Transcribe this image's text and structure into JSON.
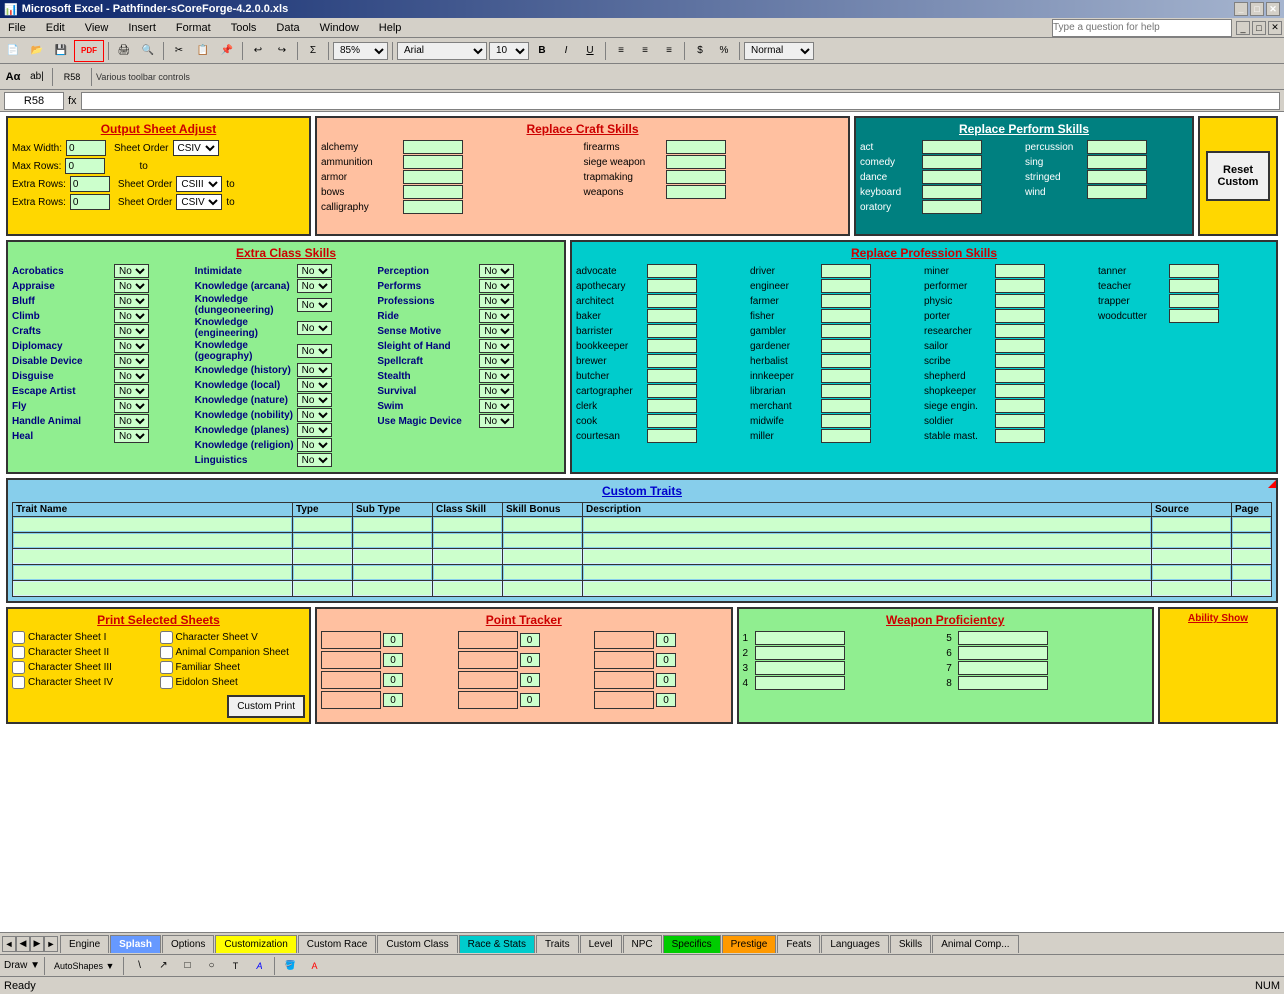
{
  "window": {
    "title": "Microsoft Excel - Pathfinder-sCoreForge-4.2.0.0.xls"
  },
  "menu": {
    "items": [
      "File",
      "Edit",
      "View",
      "Insert",
      "Format",
      "Tools",
      "Data",
      "Window",
      "Help"
    ]
  },
  "formula_bar": {
    "cell_ref": "R58",
    "formula": ""
  },
  "cell_question": "Type a question for help",
  "zoom": "85%",
  "font": "Arial",
  "font_size": "10",
  "normal_label": "Normal",
  "output_sheet": {
    "title": "Output Sheet Adjust",
    "fields": [
      {
        "label": "Max Width:",
        "value": "0",
        "order_label": "Sheet Order",
        "order_value": "CSIV",
        "to": ""
      },
      {
        "label": "Max Rows:",
        "value": "0",
        "to": "to"
      },
      {
        "label": "Extra Rows:",
        "value": "0",
        "order_label": "Sheet Order",
        "order_value": "CSIII",
        "to": "to"
      },
      {
        "label": "Extra Rows:",
        "value": "0",
        "order_label": "Sheet Order",
        "order_value": "CSIV",
        "to": "to"
      }
    ]
  },
  "craft_skills": {
    "title": "Replace Craft Skills",
    "items": [
      {
        "label": "alchemy",
        "col2_label": "firearms"
      },
      {
        "label": "ammunition",
        "col2_label": "siege weapon"
      },
      {
        "label": "armor",
        "col2_label": "trapmaking"
      },
      {
        "label": "bows",
        "col2_label": "weapons"
      },
      {
        "label": "calligraphy",
        "col2_label": ""
      }
    ]
  },
  "perform_skills": {
    "title": "Replace Perform Skills",
    "col1": [
      "act",
      "comedy",
      "dance",
      "keyboard",
      "oratory"
    ],
    "col2": [
      "percussion",
      "sing",
      "stringed",
      "wind"
    ]
  },
  "reset_button": {
    "line1": "Reset",
    "line2": "Custom"
  },
  "extra_class_skills": {
    "title": "Extra Class Skills",
    "col1": [
      {
        "label": "Acrobatics",
        "value": "No"
      },
      {
        "label": "Appraise",
        "value": "No"
      },
      {
        "label": "Bluff",
        "value": "No"
      },
      {
        "label": "Climb",
        "value": "No"
      },
      {
        "label": "Crafts",
        "value": "No"
      },
      {
        "label": "Diplomacy",
        "value": "No"
      },
      {
        "label": "Disable Device",
        "value": "No"
      },
      {
        "label": "Disguise",
        "value": "No"
      },
      {
        "label": "Escape Artist",
        "value": "No"
      },
      {
        "label": "Fly",
        "value": "No"
      },
      {
        "label": "Handle Animal",
        "value": "No"
      },
      {
        "label": "Heal",
        "value": "No"
      }
    ],
    "col2": [
      {
        "label": "Intimidate",
        "value": "No"
      },
      {
        "label": "Knowledge (arcana)",
        "value": "No"
      },
      {
        "label": "Knowledge (dungeoneering)",
        "value": "No"
      },
      {
        "label": "Knowledge (engineering)",
        "value": "No"
      },
      {
        "label": "Knowledge (geography)",
        "value": "No"
      },
      {
        "label": "Knowledge (history)",
        "value": "No"
      },
      {
        "label": "Knowledge (local)",
        "value": "No"
      },
      {
        "label": "Knowledge (nature)",
        "value": "No"
      },
      {
        "label": "Knowledge (nobility)",
        "value": "No"
      },
      {
        "label": "Knowledge (planes)",
        "value": "No"
      },
      {
        "label": "Knowledge (religion)",
        "value": "No"
      },
      {
        "label": "Linguistics",
        "value": "No"
      }
    ],
    "col3": [
      {
        "label": "Perception",
        "value": "No"
      },
      {
        "label": "Performs",
        "value": "No"
      },
      {
        "label": "Professions",
        "value": "No"
      },
      {
        "label": "Ride",
        "value": "No"
      },
      {
        "label": "Sense Motive",
        "value": "No"
      },
      {
        "label": "Sleight of Hand",
        "value": "No"
      },
      {
        "label": "Spellcraft",
        "value": "No"
      },
      {
        "label": "Stealth",
        "value": "No"
      },
      {
        "label": "Survival",
        "value": "No"
      },
      {
        "label": "Swim",
        "value": "No"
      },
      {
        "label": "Use Magic Device",
        "value": "No"
      }
    ]
  },
  "profession_skills": {
    "title": "Replace Profession Skills",
    "col1": [
      "advocate",
      "apothecary",
      "architect",
      "baker",
      "barrister",
      "bookkeeper",
      "brewer",
      "butcher",
      "cartographer",
      "clerk",
      "cook",
      "courtesan"
    ],
    "col2": [
      "driver",
      "engineer",
      "farmer",
      "fisher",
      "gambler",
      "gardener",
      "herbalist",
      "innkeeper",
      "librarian",
      "merchant",
      "midwife",
      "miller"
    ],
    "col3": [
      "miner",
      "performer",
      "physic",
      "porter",
      "researcher",
      "sailor",
      "scribe",
      "shepherd",
      "shopkeeper",
      "siege engin.",
      "soldier",
      "stable mast."
    ],
    "col4": [
      "tanner",
      "teacher",
      "trapper",
      "woodcutter"
    ]
  },
  "custom_traits": {
    "title": "Custom Traits",
    "columns": [
      "Trait Name",
      "Type",
      "Sub Type",
      "Class Skill",
      "Skill Bonus",
      "Description",
      "Source",
      "Page"
    ],
    "rows": 5
  },
  "print_sheets": {
    "title": "Print Selected Sheets",
    "checkboxes_col1": [
      "Character Sheet I",
      "Character Sheet II",
      "Character Sheet III",
      "Character Sheet IV"
    ],
    "checkboxes_col2": [
      "Character Sheet V",
      "Animal Companion Sheet",
      "Familiar Sheet",
      "Eidolon Sheet"
    ],
    "custom_print": "Custom Print"
  },
  "point_tracker": {
    "title": "Point Tracker"
  },
  "weapon_proficiency": {
    "title": "Weapon Proficientcy",
    "numbers": [
      "1",
      "2",
      "3",
      "4",
      "5",
      "6",
      "7",
      "8"
    ]
  },
  "ability_show": {
    "title": "Ability Show"
  },
  "tabs": [
    {
      "label": "Engine",
      "style": "normal"
    },
    {
      "label": "Splash",
      "style": "blue",
      "active": true
    },
    {
      "label": "Options",
      "style": "normal"
    },
    {
      "label": "Customization",
      "style": "yellow"
    },
    {
      "label": "Custom Race",
      "style": "normal"
    },
    {
      "label": "Custom Class",
      "style": "normal"
    },
    {
      "label": "Race & Stats",
      "style": "teal"
    },
    {
      "label": "Traits",
      "style": "normal"
    },
    {
      "label": "Level",
      "style": "normal"
    },
    {
      "label": "NPC",
      "style": "normal"
    },
    {
      "label": "Specifics",
      "style": "green"
    },
    {
      "label": "Prestige",
      "style": "orange"
    },
    {
      "label": "Feats",
      "style": "normal"
    },
    {
      "label": "Languages",
      "style": "normal"
    },
    {
      "label": "Skills",
      "style": "normal"
    },
    {
      "label": "Animal Comp...",
      "style": "normal"
    }
  ],
  "status": {
    "ready": "Ready",
    "num": "NUM"
  }
}
